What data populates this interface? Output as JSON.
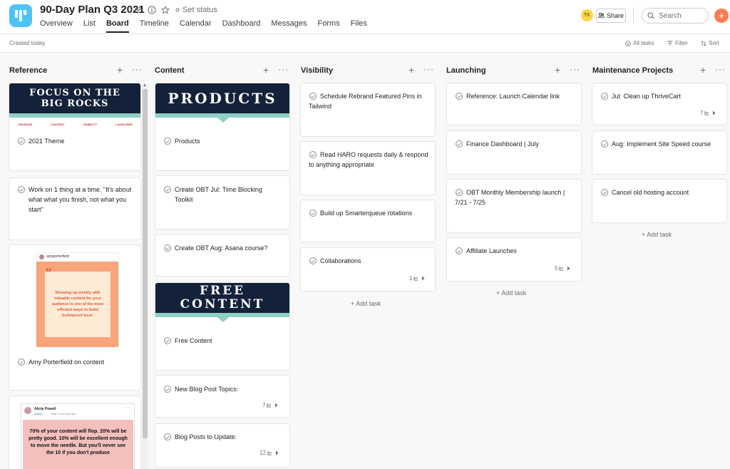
{
  "header": {
    "project_title": "90-Day Plan Q3 2021",
    "set_status": "Set status",
    "tabs": [
      {
        "label": "Overview"
      },
      {
        "label": "List"
      },
      {
        "label": "Board"
      },
      {
        "label": "Timeline"
      },
      {
        "label": "Calendar"
      },
      {
        "label": "Dashboard"
      },
      {
        "label": "Messages"
      },
      {
        "label": "Forms"
      },
      {
        "label": "Files"
      }
    ],
    "active_tab": "Board",
    "avatar_initials": "TK",
    "share_label": "Share",
    "search_placeholder": "Search",
    "accent_color": "#fc7b52",
    "logo_color": "#4fc3f7"
  },
  "toolbar": {
    "created": "Created today",
    "all_tasks": "All tasks",
    "filter": "Filter",
    "sort": "Sort"
  },
  "columns": [
    {
      "title": "Reference",
      "cards": [
        {
          "name": "2021 Theme",
          "cover": {
            "line1": "FOCUS ON THE",
            "line2": "BIG ROCKS",
            "tags": [
              "REVENUE",
              "CONTENT",
              "VISIBILITY",
              "LAUNCHING"
            ]
          }
        },
        {
          "name": "Work on 1 thing at a time. \"It's about what what you finish, not what you start\""
        },
        {
          "name": "Amy Porterfield on content",
          "cover": {
            "handle": "amyporterfield",
            "quote": "Showing up weekly with valuable content for your audience is one of the most efficient ways to build bulletproof trust."
          }
        },
        {
          "name": "",
          "cover": {
            "author": "Alicia Powell",
            "role": "Admin",
            "meta": "May 24 at 9:00 AM",
            "quote": "70% of your content will flop. 20% will be pretty good. 10% will be excellent enough to move the needle. But you'll never see the 10 if you don't produce"
          }
        }
      ]
    },
    {
      "title": "Content",
      "cards": [
        {
          "name": "Products",
          "cover": {
            "line1": "PRODUCTS"
          }
        },
        {
          "name": "Create OBT Jul: Time Blocking Toolkit"
        },
        {
          "name": "Create OBT Aug: Asana course?"
        },
        {
          "name": "Free Content",
          "cover": {
            "line1": "FREE",
            "line2": "CONTENT"
          }
        },
        {
          "name": "New Blog Post Topics:",
          "subtasks": "7"
        },
        {
          "name": "Blog Posts to Update:",
          "subtasks": "12"
        }
      ]
    },
    {
      "title": "Visibility",
      "cards": [
        {
          "name": "Schedule Rebrand Featured Pins in Tailwind"
        },
        {
          "name": "Read HARO requests daily & respond to anything appropriate"
        },
        {
          "name": "Build up Smarterqueue rotations"
        },
        {
          "name": "Collaborations",
          "subtasks": "1"
        }
      ],
      "add_task": "+ Add task"
    },
    {
      "title": "Launching",
      "cards": [
        {
          "name": "Reference: Launch Calendar link"
        },
        {
          "name": "Finance Dashboard | July"
        },
        {
          "name": "OBT Monthly Membership launch | 7/21 - 7/25"
        },
        {
          "name": "Affiliate Launches",
          "subtasks": "5"
        }
      ],
      "add_task": "+ Add task"
    },
    {
      "title": "Maintenance Projects",
      "cards": [
        {
          "name": "Jul: Clean up ThriveCart",
          "subtasks": "7"
        },
        {
          "name": "Aug: Implement Site Speed course"
        },
        {
          "name": "Cancel old hosting account"
        }
      ],
      "add_task": "+ Add task"
    }
  ]
}
